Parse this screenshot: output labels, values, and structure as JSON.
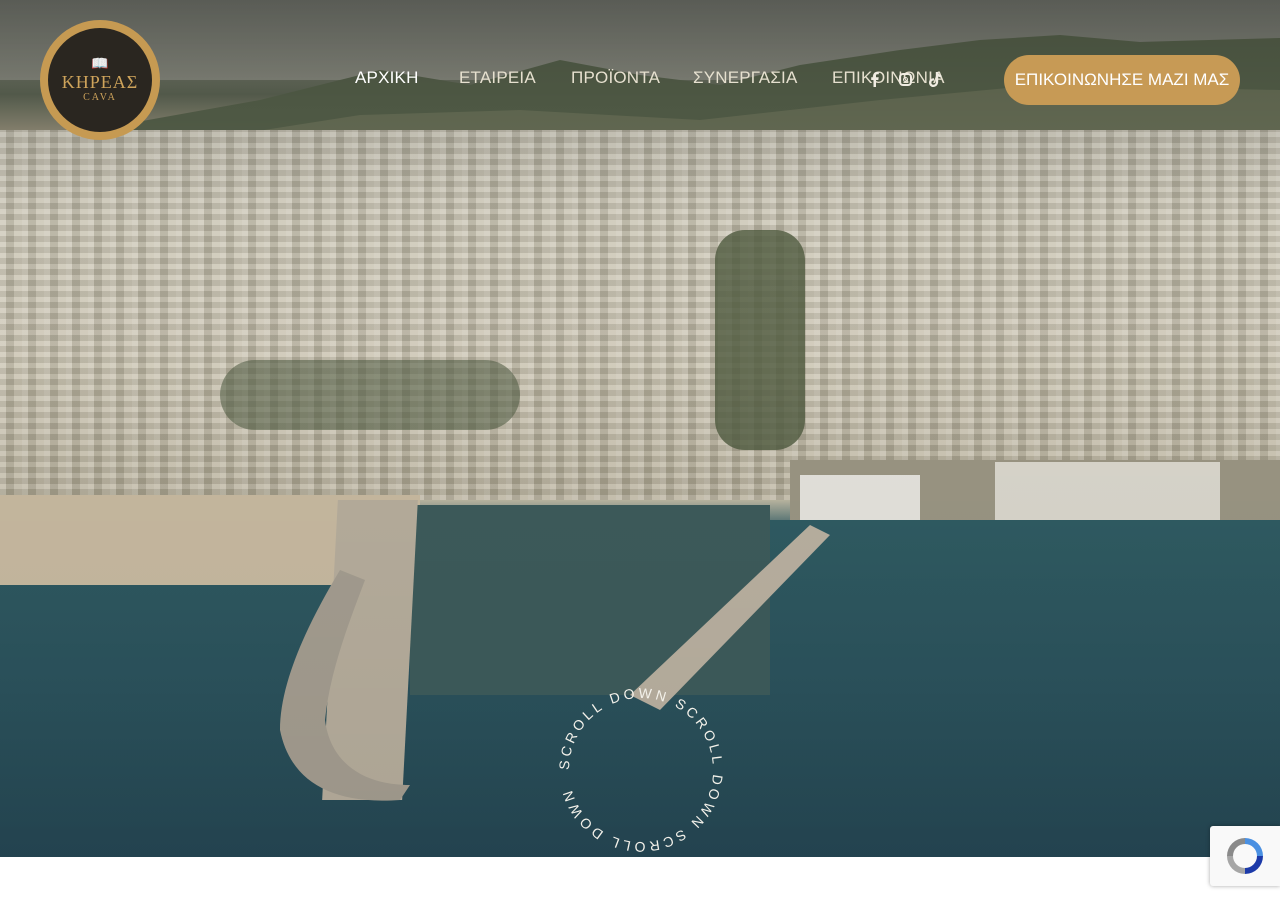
{
  "logo": {
    "name": "ΚΗΡΕΑΣ",
    "sub": "CAVA"
  },
  "nav": {
    "items": [
      {
        "label": "ΑΡΧΙΚΗ",
        "active": true
      },
      {
        "label": "ΕΤΑΙΡΕΙΑ",
        "active": false
      },
      {
        "label": "ΠΡΟΪΟΝΤΑ",
        "active": false
      },
      {
        "label": "ΣΥΝΕΡΓΑΣΙΑ",
        "active": false
      },
      {
        "label": "ΕΠΙΚΟΙΝΩΝΙΑ",
        "active": false
      }
    ]
  },
  "social": {
    "icons": [
      "facebook-icon",
      "instagram-icon",
      "tiktok-icon"
    ]
  },
  "cta": {
    "label": "ΕΠΙΚΟΙΝΩΝΗΣΕ ΜΑΖΙ ΜΑΣ"
  },
  "scroll": {
    "ring_text": "SCROLL DOWN SCROLL DOWN SCROLL DOWN "
  },
  "colors": {
    "accent": "#c79a55",
    "logo_dark": "#2a2620"
  }
}
